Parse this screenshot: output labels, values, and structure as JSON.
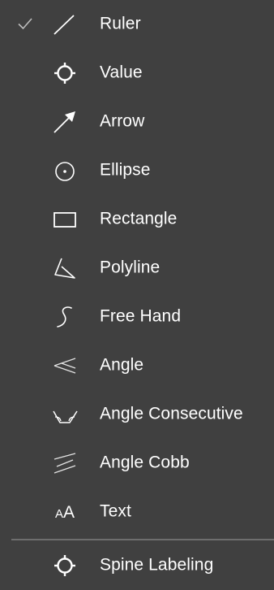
{
  "colors": {
    "background": "#404040",
    "text": "#ffffff",
    "icon": "#ffffff",
    "check": "#bdbdbd",
    "divider": "#6e6e6e"
  },
  "menu": {
    "items": [
      {
        "label": "Ruler",
        "icon": "ruler-icon",
        "checked": true
      },
      {
        "label": "Value",
        "icon": "crosshair-circle-icon",
        "checked": false
      },
      {
        "label": "Arrow",
        "icon": "arrow-icon",
        "checked": false
      },
      {
        "label": "Ellipse",
        "icon": "ellipse-icon",
        "checked": false
      },
      {
        "label": "Rectangle",
        "icon": "rectangle-icon",
        "checked": false
      },
      {
        "label": "Polyline",
        "icon": "polyline-icon",
        "checked": false
      },
      {
        "label": "Free Hand",
        "icon": "freehand-icon",
        "checked": false
      },
      {
        "label": "Angle",
        "icon": "angle-icon",
        "checked": false
      },
      {
        "label": "Angle Consecutive",
        "icon": "angle-consecutive-icon",
        "checked": false
      },
      {
        "label": "Angle Cobb",
        "icon": "angle-cobb-icon",
        "checked": false
      },
      {
        "label": "Text",
        "icon": "text-icon",
        "checked": false
      }
    ],
    "footer_items": [
      {
        "label": "Spine Labeling",
        "icon": "spine-labeling-icon",
        "checked": false
      }
    ]
  }
}
